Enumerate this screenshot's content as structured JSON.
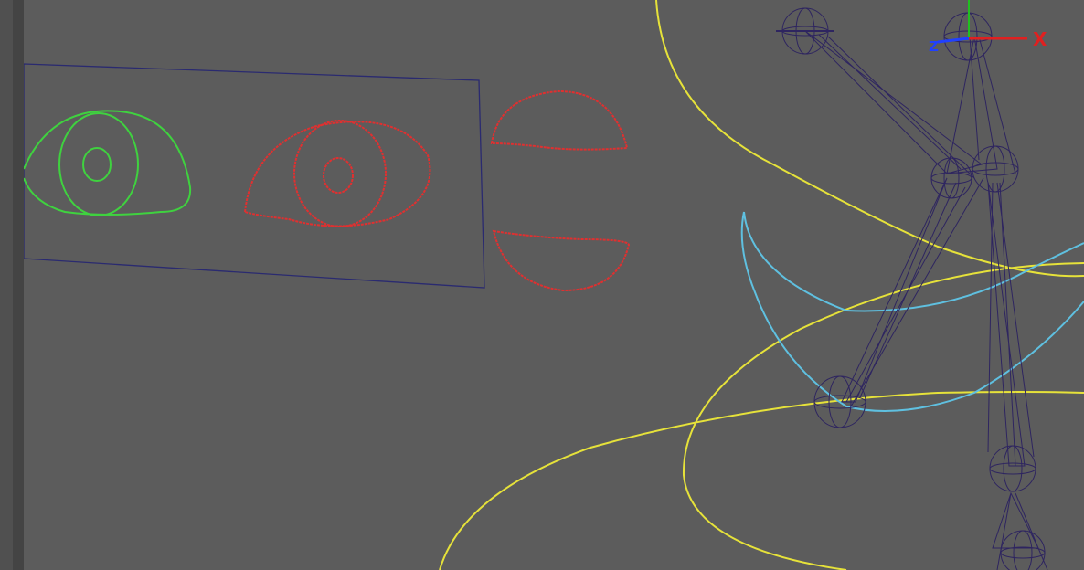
{
  "viewport": {
    "background": "#5c5c5c",
    "colors": {
      "green_eye": "#3fd23f",
      "red_eye": "#e03030",
      "red_lids": "#e03030",
      "yellow_curves": "#e6e23a",
      "blue_curve": "#5fc0e0",
      "joints": "#2e2560",
      "frame": "#2a2a70"
    }
  },
  "axis_gizmo": {
    "x_label": "X",
    "z_label": "Z",
    "x_color": "#e02020",
    "z_color": "#2040ff",
    "y_color": "#20c020"
  },
  "icons": {
    "joint": "joint-sphere-icon",
    "axis": "axis-gizmo-icon"
  }
}
